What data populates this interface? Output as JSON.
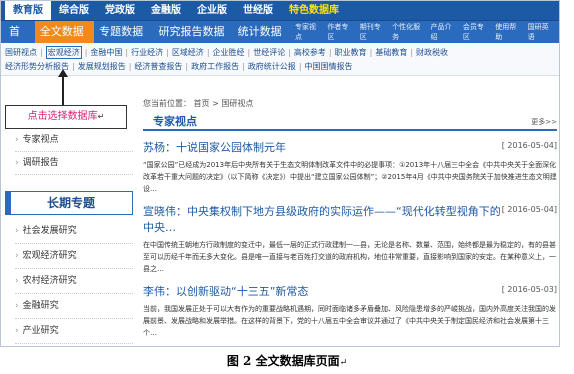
{
  "top_tabs": [
    "教育版",
    "综合版",
    "党政版",
    "金融版",
    "企业版",
    "世经版",
    "特色数据库"
  ],
  "nav": {
    "items": [
      "首页",
      "全文数据库",
      "专题数据库",
      "研究报告数据库",
      "统计数据库"
    ],
    "right": [
      "专家视点",
      "作者专区",
      "期刊专区",
      "个性化服务",
      "产品介绍",
      "会员专区",
      "使用帮助",
      "国研英语"
    ]
  },
  "sublinks": {
    "row1": [
      "国研视点",
      "宏观经济",
      "金融中国",
      "行业经济",
      "区域经济",
      "企业胜经",
      "世经评论",
      "高校参考",
      "职业教育",
      "基础教育",
      "财政税收"
    ],
    "row2": [
      "经济形势分析报告",
      "发展规划报告",
      "经济普查报告",
      "政府工作报告",
      "政府统计公报",
      "中国国情报告"
    ]
  },
  "callout": {
    "text": "点击选择数据库",
    "mark": "↵"
  },
  "left": {
    "links1": [
      "专家视点",
      "调研报告"
    ],
    "heading": "长期专题",
    "links2": [
      "社会发展研究",
      "宏观经济研究",
      "农村经济研究",
      "金融研究",
      "产业研究"
    ]
  },
  "main": {
    "crumb": "您当前位置：  首页 > 国研视点",
    "section_title": "专家视点",
    "more": "更多>>",
    "articles": [
      {
        "title": "苏杨：十说国家公园体制元年",
        "date": "[ 2016-05-04]",
        "summary": "“国家公园”已经成为2013年后中央所有关于生态文明体制改革文件中的必提事项：①2013年十八届三中全会《中共中央关于全面深化改革若干重大问题的决定》（以下简称《决定》）中提出“建立国家公园体制”；②2015年4月《中共中央国务院关于加快推进生态文明建设…"
      },
      {
        "title": "宣晓伟：中央集权制下地方县级政府的实际运作——“现代化转型视角下的中央…",
        "date": "[ 2016-05-04]",
        "summary": "在中国传统王朝地方行政制度的变迁中，最低一层的正式行政建制一—县，无论是名称、数量、范围，始终都是最为稳定的，有的县甚至可以历经千年而无多大变化。县是唯一直接与老百姓打交道的政府机构，地位非常重要，直接影响到国家的安定。在某种意义上，一县之…"
      },
      {
        "title": "李伟：以创新驱动“十三五”新常态",
        "date": "[ 2016-05-03]",
        "summary": "当前，我国发展正处于可以大有作为的重要战略机遇期，同时面临诸多矛盾叠加、风险隐患增多的严峻挑战，国内外高度关注我国的发展前景、发展战略和发展举措。在这样的背景下，党的十八届五中全会审议并通过了《中共中央关于制定国民经济和社会发展第十三个…"
      }
    ]
  },
  "caption": {
    "text": "图 2  全文数据库页面",
    "mark": "↵"
  }
}
